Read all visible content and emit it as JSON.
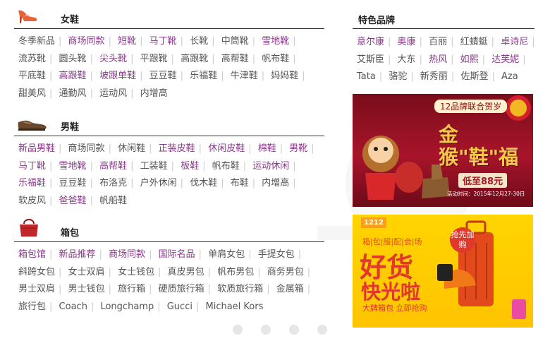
{
  "women": {
    "title": "女鞋",
    "links": [
      {
        "label": "冬季新品",
        "hot": false
      },
      {
        "label": "商场同款",
        "hot": true
      },
      {
        "label": "短靴",
        "hot": true
      },
      {
        "label": "马丁靴",
        "hot": true
      },
      {
        "label": "长靴",
        "hot": false
      },
      {
        "label": "中筒靴",
        "hot": false
      },
      {
        "label": "雪地靴",
        "hot": true
      },
      {
        "label": "流苏靴",
        "hot": false
      },
      {
        "label": "圆头靴",
        "hot": false
      },
      {
        "label": "尖头靴",
        "hot": true
      },
      {
        "label": "平跟靴",
        "hot": false
      },
      {
        "label": "高跟靴",
        "hot": false
      },
      {
        "label": "高帮鞋",
        "hot": false
      },
      {
        "label": "帆布鞋",
        "hot": false
      },
      {
        "label": "平底鞋",
        "hot": false
      },
      {
        "label": "高跟鞋",
        "hot": true
      },
      {
        "label": "坡跟单鞋",
        "hot": true
      },
      {
        "label": "豆豆鞋",
        "hot": false
      },
      {
        "label": "乐福鞋",
        "hot": false
      },
      {
        "label": "牛津鞋",
        "hot": false
      },
      {
        "label": "妈妈鞋",
        "hot": false
      },
      {
        "label": "甜美风",
        "hot": false
      },
      {
        "label": "通勤风",
        "hot": false
      },
      {
        "label": "运动风",
        "hot": false
      },
      {
        "label": "内增高",
        "hot": false
      }
    ]
  },
  "men": {
    "title": "男鞋",
    "links": [
      {
        "label": "新品男鞋",
        "hot": true
      },
      {
        "label": "商场同款",
        "hot": false
      },
      {
        "label": "休闲鞋",
        "hot": false
      },
      {
        "label": "正装皮鞋",
        "hot": true
      },
      {
        "label": "休闲皮鞋",
        "hot": true
      },
      {
        "label": "棉鞋",
        "hot": true
      },
      {
        "label": "男靴",
        "hot": true
      },
      {
        "label": "马丁靴",
        "hot": true
      },
      {
        "label": "雪地靴",
        "hot": true
      },
      {
        "label": "高帮鞋",
        "hot": true
      },
      {
        "label": "工装鞋",
        "hot": false
      },
      {
        "label": "板鞋",
        "hot": true
      },
      {
        "label": "帆布鞋",
        "hot": false
      },
      {
        "label": "运动休闲",
        "hot": true
      },
      {
        "label": "乐福鞋",
        "hot": true
      },
      {
        "label": "豆豆鞋",
        "hot": false
      },
      {
        "label": "布洛克",
        "hot": false
      },
      {
        "label": "户外休闲",
        "hot": false
      },
      {
        "label": "伐木鞋",
        "hot": false
      },
      {
        "label": "布鞋",
        "hot": false
      },
      {
        "label": "内增高",
        "hot": false
      },
      {
        "label": "软皮风",
        "hot": false
      },
      {
        "label": "爸爸鞋",
        "hot": true
      },
      {
        "label": "帆船鞋",
        "hot": false
      }
    ]
  },
  "bags": {
    "title": "箱包",
    "links": [
      {
        "label": "箱包馆",
        "hot": true
      },
      {
        "label": "新品推荐",
        "hot": true
      },
      {
        "label": "商场同款",
        "hot": true
      },
      {
        "label": "国际名品",
        "hot": true
      },
      {
        "label": "单肩女包",
        "hot": false
      },
      {
        "label": "手提女包",
        "hot": false
      },
      {
        "label": "斜跨女包",
        "hot": false
      },
      {
        "label": "女士双肩",
        "hot": false
      },
      {
        "label": "女士钱包",
        "hot": false
      },
      {
        "label": "真皮男包",
        "hot": false
      },
      {
        "label": "帆布男包",
        "hot": false
      },
      {
        "label": "商务男包",
        "hot": false
      },
      {
        "label": "男士双肩",
        "hot": false
      },
      {
        "label": "男士钱包",
        "hot": false
      },
      {
        "label": "旅行箱",
        "hot": false
      },
      {
        "label": "硬质旅行箱",
        "hot": false
      },
      {
        "label": "软质旅行箱",
        "hot": false
      },
      {
        "label": "金属箱",
        "hot": false
      },
      {
        "label": "旅行包",
        "hot": false
      },
      {
        "label": "Coach",
        "hot": false
      },
      {
        "label": "Longchamp",
        "hot": false
      },
      {
        "label": "Gucci",
        "hot": false
      },
      {
        "label": "Michael Kors",
        "hot": false
      }
    ]
  },
  "brands": {
    "title": "特色品牌",
    "links": [
      {
        "label": "意尔康",
        "hot": true
      },
      {
        "label": "奥康",
        "hot": true
      },
      {
        "label": "百丽",
        "hot": false
      },
      {
        "label": "红蜻蜓",
        "hot": false
      },
      {
        "label": "卓诗尼",
        "hot": true
      },
      {
        "label": "艾斯臣",
        "hot": false
      },
      {
        "label": "大东",
        "hot": false
      },
      {
        "label": "热风",
        "hot": true
      },
      {
        "label": "如熙",
        "hot": true
      },
      {
        "label": "达芙妮",
        "hot": true
      },
      {
        "label": "Tata",
        "hot": false
      },
      {
        "label": "骆驼",
        "hot": false
      },
      {
        "label": "新秀丽",
        "hot": false
      },
      {
        "label": "佐斯登",
        "hot": false
      },
      {
        "label": "Aza",
        "hot": false
      }
    ]
  },
  "banner1": {
    "tag": "12品牌联合贺岁",
    "headline": "金猴\"鞋\"福",
    "price": "低至88元",
    "date": "活动时间：2015年12月27-30日"
  },
  "banner2": {
    "logo": "1212",
    "sub": "箱|包|服|配|会|场",
    "head1": "好货",
    "head2": "快光啦",
    "tag": "抢先加购",
    "foot": "大牌箱包 立即抢购"
  },
  "colors": {
    "link": "#555555",
    "hot": "#8a3a8a",
    "sep": "#cccccc"
  }
}
